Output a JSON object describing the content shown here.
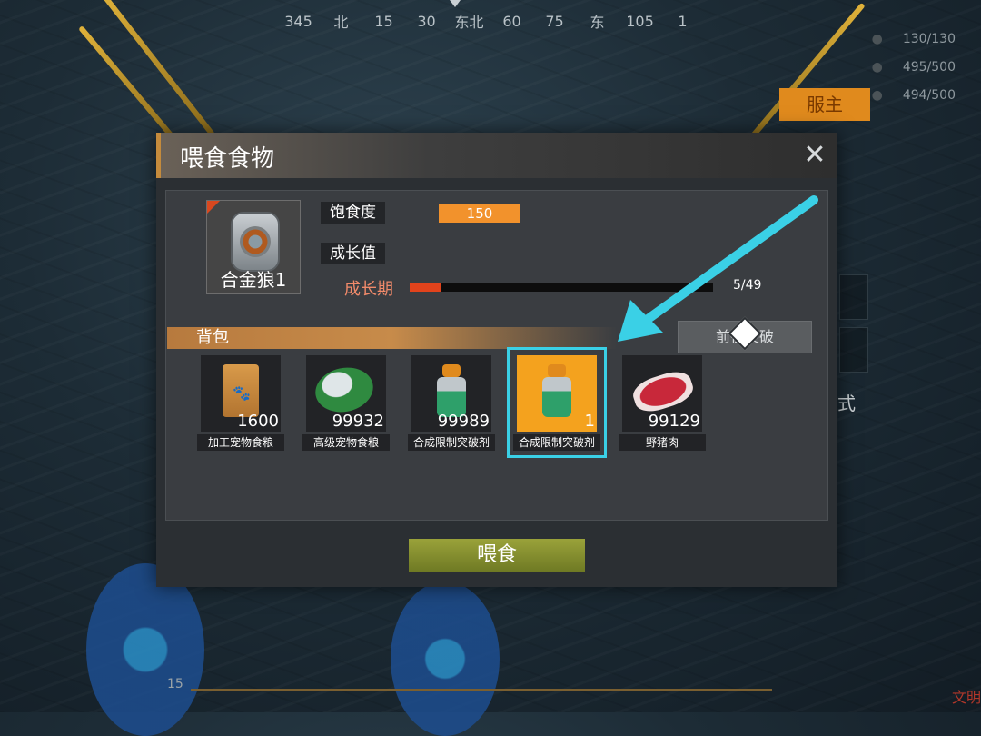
{
  "hud": {
    "compass": [
      "345",
      "北",
      "15",
      "30",
      "东北",
      "60",
      "75",
      "东",
      "105",
      "1"
    ],
    "stats": [
      "130/130",
      "495/500",
      "494/500"
    ],
    "fuzhu_button": "服主",
    "side_label": "式",
    "bottom_number": "15",
    "bottom_right_text": "文明"
  },
  "dialog": {
    "title": "喂食食物",
    "close_symbol": "✕",
    "pet": {
      "name": "合金狼1"
    },
    "stats": {
      "satiety_label": "饱食度",
      "satiety_value": "150",
      "growth_value_label": "成长值",
      "growth_stage_label": "成长期",
      "growth_progress_text": "5/49",
      "growth_progress_fraction": 0.102
    },
    "bag": {
      "title": "背包",
      "goto_button": "前往突破",
      "items": [
        {
          "name": "加工宠物食粮",
          "count": "1600",
          "art": "pet-food-bag",
          "selected": false
        },
        {
          "name": "高级宠物食粮",
          "count": "99932",
          "art": "pet-food-can",
          "selected": false
        },
        {
          "name": "合成限制突破剂",
          "count": "99989",
          "art": "breakthrough-potion",
          "selected": false
        },
        {
          "name": "合成限制突破剂",
          "count": "1",
          "art": "breakthrough-potion",
          "selected": true
        },
        {
          "name": "野猪肉",
          "count": "99129",
          "art": "boar-meat",
          "selected": false
        }
      ]
    },
    "feed_button": "喂食"
  },
  "colors": {
    "selection_highlight": "#f4a21e",
    "guide_arrow": "#3ad0e6",
    "satiety_bar": "#f2922c",
    "growth_fill": "#e1431c"
  }
}
